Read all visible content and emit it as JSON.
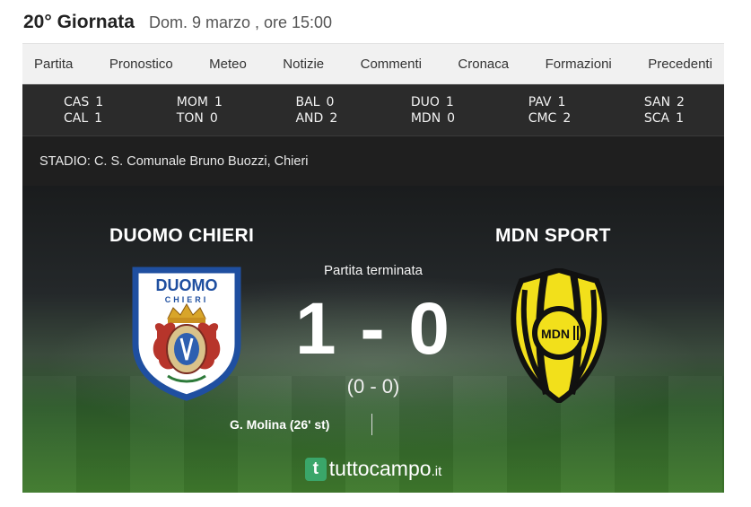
{
  "header": {
    "round": "20° Giornata",
    "datetime": "Dom. 9 marzo , ore 15:00"
  },
  "tabs": [
    "Partita",
    "Pronostico",
    "Meteo",
    "Notizie",
    "Commenti",
    "Cronaca",
    "Formazioni",
    "Precedenti"
  ],
  "results": [
    {
      "home": "CAS",
      "home_score": "1",
      "away": "CAL",
      "away_score": "1"
    },
    {
      "home": "MOM",
      "home_score": "1",
      "away": "TON",
      "away_score": "0"
    },
    {
      "home": "BAL",
      "home_score": "0",
      "away": "AND",
      "away_score": "2"
    },
    {
      "home": "DUO",
      "home_score": "1",
      "away": "MDN",
      "away_score": "0"
    },
    {
      "home": "PAV",
      "home_score": "1",
      "away": "CMC",
      "away_score": "2"
    },
    {
      "home": "SAN",
      "home_score": "2",
      "away": "SCA",
      "away_score": "1"
    }
  ],
  "stadium": "STADIO: C. S. Comunale Bruno Buozzi, Chieri",
  "match": {
    "home_team": "DUOMO CHIERI",
    "away_team": "MDN SPORT",
    "status": "Partita terminata",
    "score": "1 - 0",
    "half_time": "(0 - 0)",
    "home_scorers": "G. Molina (26' st)",
    "home_logo": {
      "title": "DUOMO",
      "subtitle": "CHIERI"
    },
    "away_logo": {
      "text": "MDN"
    }
  },
  "brand": {
    "icon": "t",
    "name": "tuttocampo",
    "tld": ".it"
  },
  "colors": {
    "results_bg": "#2b2b2b",
    "tabs_bg": "#f1f1f1",
    "brand_green": "#3aa66a",
    "away_yellow": "#f2e01b",
    "home_blue": "#1f4fa0"
  }
}
